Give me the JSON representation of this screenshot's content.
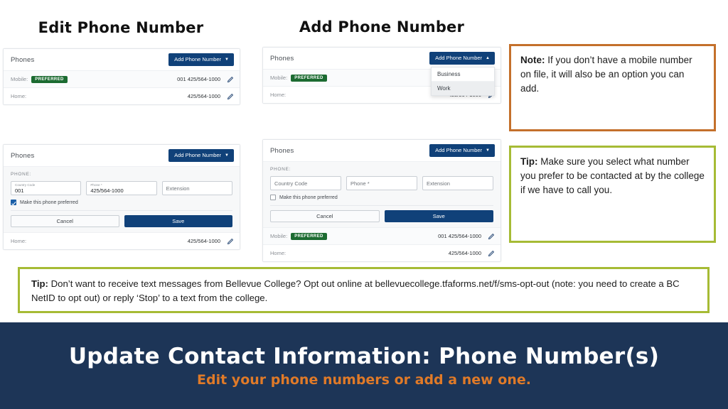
{
  "headings": {
    "edit": "Edit Phone Number",
    "add": "Add Phone Number"
  },
  "common": {
    "card_title": "Phones",
    "add_button": "Add Phone Number",
    "caret_down": "▼",
    "caret_up": "▲",
    "legend": "PHONE:",
    "cancel": "Cancel",
    "save": "Save",
    "checkbox_label": "Make this phone preferred",
    "preferred_badge": "PREFERRED",
    "label_mobile": "Mobile:",
    "label_home": "Home:",
    "mobile_number": "001 425/564-1000",
    "home_number": "425/564-1000",
    "edit_icon": "pencil-icon"
  },
  "dropdown": {
    "items": [
      {
        "label": "Business",
        "hovered": false
      },
      {
        "label": "Work",
        "hovered": true
      }
    ]
  },
  "form_filled": {
    "country_code_label": "Country Code",
    "country_code_value": "001",
    "phone_label": "Phone *",
    "phone_value": "425/564-1000",
    "extension_placeholder": "Extension",
    "checked": true
  },
  "form_empty": {
    "country_code_placeholder": "Country Code",
    "phone_placeholder": "Phone *",
    "extension_placeholder": "Extension",
    "checked": false
  },
  "callouts": {
    "note": {
      "lead": "Note:",
      "text": " If you don’t have a mobile number on file, it will also be an option you can add."
    },
    "tip_right": {
      "lead": "Tip:",
      "text": " Make sure you select what number you prefer to be contacted at by the college if we have to call you."
    },
    "tip_wide": {
      "lead": "Tip:",
      "text": " Don’t want to receive  text messages from Bellevue  College? Opt out online at bellevuecollege.tfaforms.net/f/sms-opt-out  (note: you need to create a BC NetID to opt out) or reply ‘Stop’ to a text from the college."
    }
  },
  "banner": {
    "title": "Update Contact Information: Phone Number(s)",
    "subtitle": "Edit your phone numbers or add a new one.",
    "bg_color": "#1d3557",
    "accent_color": "#e07a28"
  }
}
